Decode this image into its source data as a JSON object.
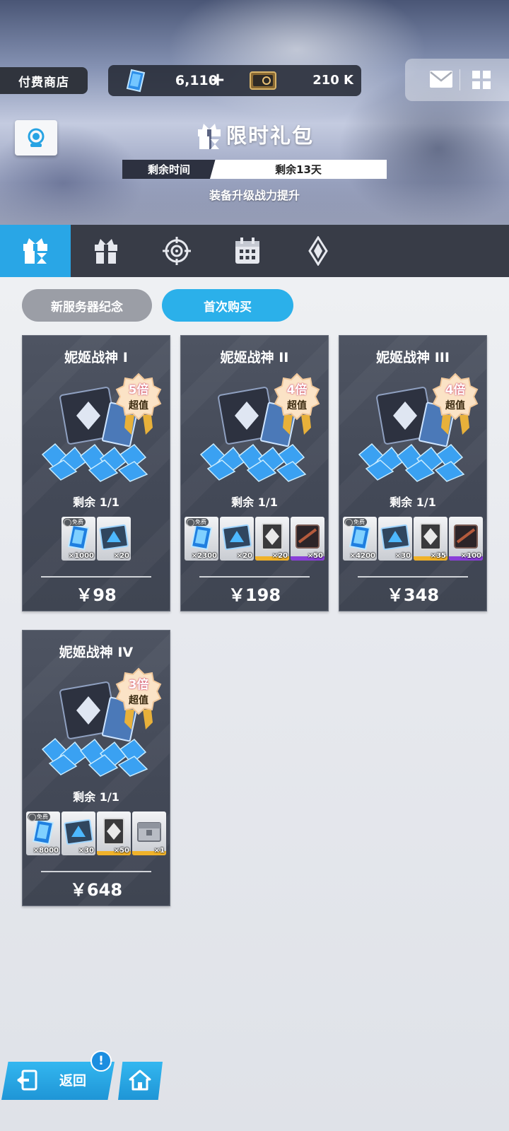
{
  "header": {
    "shop_label": "付费商店",
    "gems": "6,110",
    "gems_plus": "+",
    "tickets": "210 K",
    "title": "限时礼包",
    "timer_label": "剩余时间",
    "timer_value": "剩余13天",
    "subtitle": "装备升级战力提升"
  },
  "tabs": [
    {
      "icon": "limited-gift-icon",
      "active": true
    },
    {
      "icon": "gift-box-icon",
      "active": false
    },
    {
      "icon": "target-icon",
      "active": false
    },
    {
      "icon": "calendar-icon",
      "active": false
    },
    {
      "icon": "diamond-emblem-icon",
      "active": false
    }
  ],
  "subtabs": [
    {
      "label": "新服务器纪念",
      "active": false
    },
    {
      "label": "首次购买",
      "active": true
    }
  ],
  "packs": [
    {
      "name": "妮姬战神 I",
      "badge_multiplier": "5倍",
      "badge_text": "超值",
      "remaining": "剩余  1/1",
      "items": [
        {
          "icon": "gem-icon",
          "qty": "×1000",
          "free_label": "免费",
          "rarity": "none"
        },
        {
          "icon": "recruit-ticket-icon",
          "qty": "×20",
          "rarity": "none"
        }
      ],
      "price": "￥98"
    },
    {
      "name": "妮姬战神 II",
      "badge_multiplier": "4倍",
      "badge_text": "超值",
      "remaining": "剩余  1/1",
      "items": [
        {
          "icon": "gem-icon",
          "qty": "×2300",
          "free_label": "免费",
          "rarity": "none"
        },
        {
          "icon": "recruit-ticket-icon",
          "qty": "×20",
          "rarity": "none"
        },
        {
          "icon": "mold-icon",
          "qty": "×20",
          "rarity": "gold"
        },
        {
          "icon": "equipment-icon",
          "qty": "×50",
          "rarity": "purple"
        }
      ],
      "price": "￥198"
    },
    {
      "name": "妮姬战神 III",
      "badge_multiplier": "4倍",
      "badge_text": "超值",
      "remaining": "剩余  1/1",
      "items": [
        {
          "icon": "gem-icon",
          "qty": "×4200",
          "free_label": "免费",
          "rarity": "none"
        },
        {
          "icon": "recruit-ticket-icon",
          "qty": "×30",
          "rarity": "none"
        },
        {
          "icon": "mold-icon",
          "qty": "×35",
          "rarity": "gold"
        },
        {
          "icon": "equipment-icon",
          "qty": "×100",
          "rarity": "purple"
        }
      ],
      "price": "￥348"
    },
    {
      "name": "妮姬战神 IV",
      "badge_multiplier": "3倍",
      "badge_text": "超值",
      "remaining": "剩余  1/1",
      "items": [
        {
          "icon": "gem-icon",
          "qty": "×8000",
          "free_label": "免费",
          "rarity": "none"
        },
        {
          "icon": "recruit-ticket-icon",
          "qty": "×30",
          "rarity": "none"
        },
        {
          "icon": "mold-icon",
          "qty": "×50",
          "rarity": "gold"
        },
        {
          "icon": "supply-box-icon",
          "qty": "×1",
          "rarity": "gold"
        }
      ],
      "price": "￥648"
    }
  ],
  "footer": {
    "back_label": "返回",
    "notice_mark": "!"
  },
  "colors": {
    "accent": "#29a6e6",
    "tabbar": "#383c47",
    "card": "#474d5a",
    "gold": "#f0b22a",
    "purple": "#8a3fd8"
  }
}
